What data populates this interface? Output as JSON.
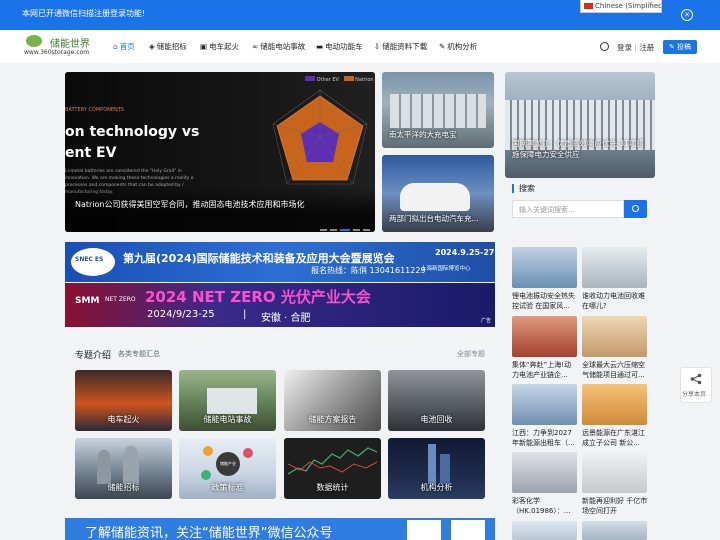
{
  "notice": {
    "text": "本网已开通微信扫描注册登录功能!",
    "language": "Chinese (Simplified)"
  },
  "logo": {
    "name_cn": "储能世界",
    "url": "www.360storage.com"
  },
  "nav": {
    "items": [
      {
        "label": "首页",
        "icon": "home-icon",
        "active": true
      },
      {
        "label": "储能招标",
        "icon": "shield-icon"
      },
      {
        "label": "电车起火",
        "icon": "car-icon"
      },
      {
        "label": "储能电站事故",
        "icon": "link-icon"
      },
      {
        "label": "电动功能车",
        "icon": "truck-icon"
      },
      {
        "label": "储能资料下载",
        "icon": "download-icon"
      },
      {
        "label": "机构分析",
        "icon": "wrench-icon"
      }
    ],
    "login": "登录",
    "separator": "|",
    "register": "注册",
    "post_button": "投稿"
  },
  "slider": {
    "tag": "BATTERY COMPONENTS",
    "headline_1": "on technology vs",
    "headline_2": "ent EV",
    "paragraph": "Li-metal batteries are considered the \"Holy Grail\" in innovation. We are making these technologies a reality e processes and components that can be adopted by / manufacturing today.",
    "legend_1": "Other EV",
    "legend_2": "Natrion",
    "caption": "Natrion公司获得美国空军合同，推动固态电池技术应用和市场化"
  },
  "cards": [
    {
      "caption": "南太平洋的大充电宝"
    },
    {
      "caption": "两部门拟出台电动汽车充..."
    },
    {
      "caption": "国网黑龙江：优质高效响应优先 31项措施保障电力安全供应"
    }
  ],
  "sidebar": {
    "search_title": "搜索",
    "search_placeholder": "输入关键词搜索..."
  },
  "banners": {
    "expo_logo": "SNEC ES",
    "expo_title": "第九届(2024)国际储能技术和装备及应用大会暨展览会",
    "expo_date": "2024.9.25-27",
    "expo_venue": "上海新国际博览中心",
    "expo_contact": "报名热线：陈俏 13041611229",
    "ad_label": "广告",
    "netzero_logo_1": "SMM",
    "netzero_logo_2": "NET ZERO",
    "netzero_title": "2024 NET ZERO 光伏产业大会",
    "netzero_date": "2024/9/23-25",
    "netzero_sep": "|",
    "netzero_place": "安徽 · 合肥"
  },
  "topics": {
    "title": "专题介绍",
    "subtitle": "各类专题汇总",
    "all_link": "全部专题",
    "items": [
      {
        "label": "电车起火",
        "color": "#b24a1e"
      },
      {
        "label": "储能电站事故",
        "color": "#5e7a52"
      },
      {
        "label": "储能方案报告",
        "color": "#7b7b7b"
      },
      {
        "label": "电池回收",
        "color": "#555a60"
      },
      {
        "label": "储能招标",
        "color": "#6d7d8c"
      },
      {
        "label": "政策标准",
        "color": "#c9d4e2"
      },
      {
        "label": "数据统计",
        "color": "#2a2a2a"
      },
      {
        "label": "机构分析",
        "color": "#1d2a4a"
      }
    ],
    "policy_inner": "储能产业"
  },
  "news": [
    {
      "text": "锂电池振动安全热失控试验 在国家风...",
      "color": "#6a8fb5"
    },
    {
      "text": "谁收动力电池回收难在哪儿?",
      "color": "#a8b5bd"
    },
    {
      "text": "集体“奔赴”上海!动力电池产业链企...",
      "color": "#a4412c"
    },
    {
      "text": "全球最大云六压缩空气储能项目通过可...",
      "color": "#c29a6a"
    },
    {
      "text": "江西：力争到2027年新能源出租车（...",
      "color": "#6f8fb0"
    },
    {
      "text": "远景能源在广东湛江成立子公司 新公...",
      "color": "#d28b38"
    },
    {
      "text": "彩客化学（HK.01986）：...",
      "color": "#9aa3ab"
    },
    {
      "text": "新能再迎利好 千亿市场空间打开",
      "color": "#c7c9cc"
    },
    {
      "text": "",
      "color": "#b9c6d4"
    },
    {
      "text": "",
      "color": "#a5b4c3"
    }
  ],
  "share": {
    "label": "分享本页"
  },
  "wechat": {
    "text": "了解储能资讯，关注“储能世界”微信公众号"
  }
}
